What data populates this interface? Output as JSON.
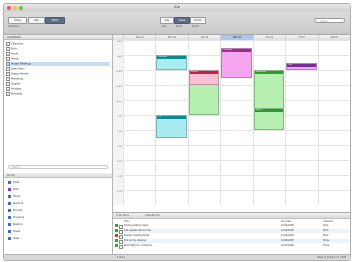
{
  "window": {
    "title": "iCal",
    "traffic": {
      "close": "#ee5b51",
      "min": "#f5bd35",
      "max": "#62c655"
    }
  },
  "toolbar": {
    "left_buttons": [
      "Today",
      "Day",
      "Week"
    ],
    "selected_view": "Week",
    "nav_buttons": [
      "Day",
      "Week",
      "Month"
    ],
    "nav_selected": "Week",
    "search_placeholder": "Search",
    "labels": [
      "Calendars",
      "Day",
      "Week",
      "Month"
    ]
  },
  "sidebar": {
    "header": "CALENDARS",
    "items": [
      {
        "label": "Calendars",
        "selected": false
      },
      {
        "label": "Work",
        "selected": false
      },
      {
        "label": "Home",
        "selected": false
      },
      {
        "label": "Family",
        "selected": false
      },
      {
        "label": "Project Meetings",
        "selected": true
      },
      {
        "label": "Sales Team",
        "selected": false
      },
      {
        "label": "Design Review",
        "selected": false
      },
      {
        "label": "Marketing",
        "selected": false
      },
      {
        "label": "Support",
        "selected": false
      },
      {
        "label": "Holidays",
        "selected": false
      },
      {
        "label": "Birthdays",
        "selected": false
      }
    ],
    "filter_placeholder": "Search",
    "tasks_header": "TO DO",
    "task_items": [
      {
        "label": "Tasks",
        "color": "#3f6fc4"
      },
      {
        "label": "Work",
        "color": "#7d3fbf"
      },
      {
        "label": "Home",
        "color": "#3f6fc4"
      },
      {
        "label": "Personal",
        "color": "#3f6fc4"
      },
      {
        "label": "Errands",
        "color": "#3f6fc4"
      },
      {
        "label": "Shopping",
        "color": "#3f6fc4"
      },
      {
        "label": "Reading",
        "color": "#3f6fc4"
      },
      {
        "label": "Travel",
        "color": "#3f6fc4"
      },
      {
        "label": "Ideas",
        "color": "#3f6fc4"
      }
    ]
  },
  "calendar": {
    "days": [
      "Sun 10",
      "Mon 11",
      "Tue 12",
      "Wed 13",
      "Thu 14",
      "Fri 15",
      "Sat 16"
    ],
    "today_index": 3,
    "hours": [
      "8 AM",
      "9 AM",
      "10 AM",
      "11 AM",
      "Noon",
      "1 PM",
      "2 PM",
      "3 PM",
      "4 PM",
      "5 PM",
      "6 PM"
    ],
    "events": [
      {
        "title": "Standup",
        "day": 1,
        "start": "9:00",
        "end": "10:00",
        "fill": "#a9ecef",
        "bar": "#0b8a8e"
      },
      {
        "title": "Design sync",
        "day": 2,
        "start": "10:00",
        "end": "13:00",
        "fill": "#b5f0b0",
        "bar": "#2a9e2a"
      },
      {
        "title": "Review",
        "day": 2,
        "start": "10:00",
        "end": "11:00",
        "fill": "#f7c1d2",
        "bar": "#c61f4b"
      },
      {
        "title": "Planning",
        "day": 3,
        "start": "8:30",
        "end": "10:30",
        "fill": "#f5a6ef",
        "bar": "#9b2a93"
      },
      {
        "title": "Workshop",
        "day": 4,
        "start": "10:00",
        "end": "13:30",
        "fill": "#b5f0b0",
        "bar": "#2a9e2a"
      },
      {
        "title": "Call",
        "day": 5,
        "start": "9:30",
        "end": "10:00",
        "fill": "#e3b4f6",
        "bar": "#7a2a9b"
      },
      {
        "title": "1:1",
        "day": 1,
        "start": "13:00",
        "end": "14:30",
        "fill": "#a9ecef",
        "bar": "#0b8a8e"
      },
      {
        "title": "Demo",
        "day": 4,
        "start": "12:30",
        "end": "14:00",
        "fill": "#b5f0b0",
        "bar": "#2a9e2a"
      }
    ]
  },
  "tasks": {
    "tab_label": "To Do Items",
    "tab2_label": "Calendar Info",
    "columns": [
      "!",
      "Title",
      "Due Date",
      "Calendar"
    ],
    "rows": [
      {
        "prio": "#2fa83a",
        "title": "Finish quarterly report",
        "due": "10/14/2008",
        "cal": "Work"
      },
      {
        "prio": "#2fa83a",
        "title": "Call supplier about order",
        "due": "10/15/2008",
        "cal": "Work"
      },
      {
        "prio": "#d23a2a",
        "title": "Prepare meeting slides",
        "due": "10/15/2008",
        "cal": "Work"
      },
      {
        "prio": "#2fa83a",
        "title": "Pick up dry cleaning",
        "due": "10/16/2008",
        "cal": "Home"
      },
      {
        "prio": "#2fa83a",
        "title": "Book flight for conference",
        "due": "10/17/2008",
        "cal": "Travel"
      }
    ]
  },
  "status": {
    "text": "5 items",
    "right": "Week of October 12, 2008"
  }
}
